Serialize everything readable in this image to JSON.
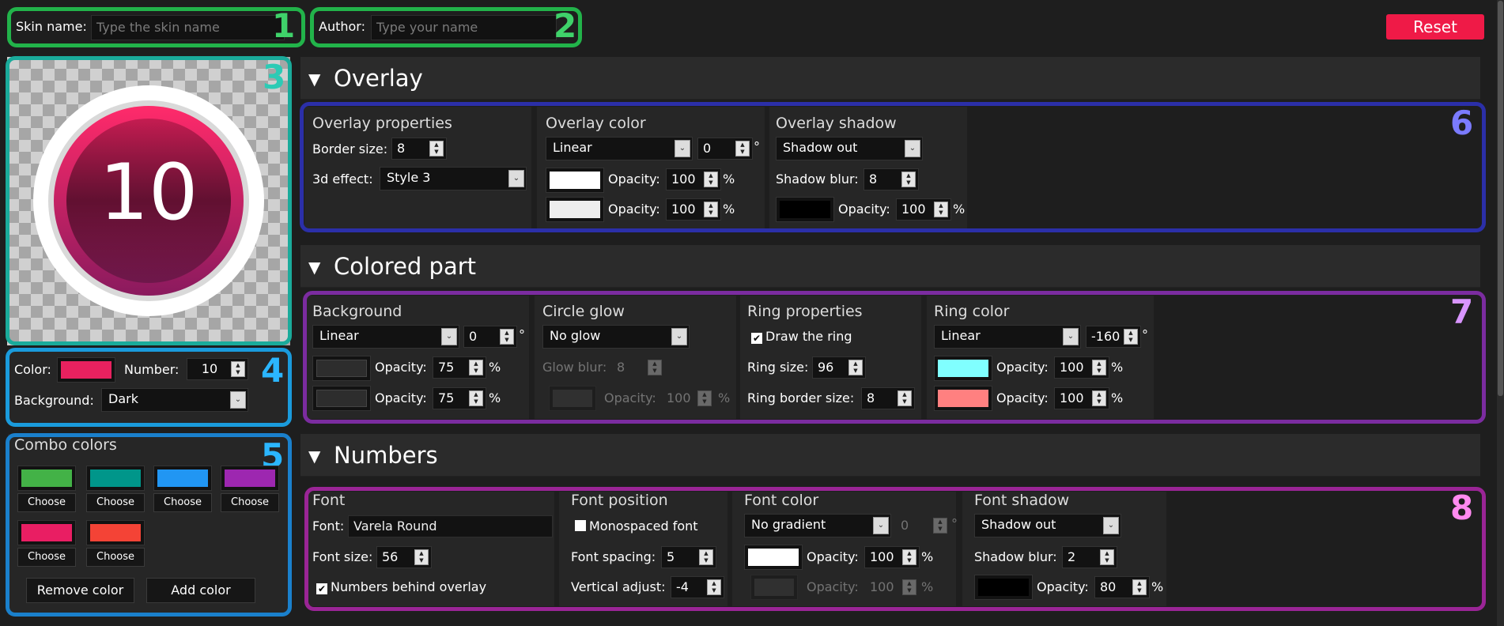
{
  "top": {
    "skin_name_label": "Skin name:",
    "skin_name_placeholder": "Type the skin name",
    "author_label": "Author:",
    "author_placeholder": "Type your name",
    "reset": "Reset"
  },
  "preview": {
    "number": "10"
  },
  "badges": [
    "1",
    "2",
    "3",
    "4",
    "5",
    "6",
    "7",
    "8"
  ],
  "settings": {
    "color_label": "Color:",
    "color": "#e8215f",
    "number_label": "Number:",
    "number": "10",
    "background_label": "Background:",
    "background": "Dark"
  },
  "combo": {
    "title": "Combo colors",
    "colors": [
      "#43b247",
      "#00968a",
      "#2196f3",
      "#9d27b0",
      "#e91e63",
      "#f44336"
    ],
    "choose": "Choose",
    "remove": "Remove color",
    "add": "Add color"
  },
  "overlay": {
    "title": "Overlay",
    "props_title": "Overlay properties",
    "border_label": "Border size:",
    "border": "8",
    "effect_label": "3d effect:",
    "effect": "Style 3",
    "color_title": "Overlay color",
    "gradient": "Linear",
    "angle": "0",
    "deg": "°",
    "opacity_label": "Opacity:",
    "op1": "100",
    "op2": "100",
    "pct": "%",
    "c1": "#ffffff",
    "c2": "#eeeeee",
    "shadow_title": "Overlay shadow",
    "shadow": "Shadow out",
    "blur_label": "Shadow blur:",
    "blur": "8",
    "shadow_color": "#000000",
    "shadow_op": "100"
  },
  "colored": {
    "title": "Colored part",
    "bg_title": "Background",
    "bg_grad": "Linear",
    "bg_angle": "0",
    "bg_op1": "75",
    "bg_op2": "75",
    "glow_title": "Circle glow",
    "glow": "No glow",
    "glow_blur_label": "Glow blur:",
    "glow_blur": "8",
    "glow_op": "100",
    "ring_title": "Ring properties",
    "draw_ring": "Draw the ring",
    "ring_size_label": "Ring size:",
    "ring_size": "96",
    "ring_border_label": "Ring border size:",
    "ring_border": "8",
    "rc_title": "Ring color",
    "rc_grad": "Linear",
    "rc_angle": "-160",
    "rc1": "#80ffff",
    "rc2": "#ff8080",
    "rc_op1": "100",
    "rc_op2": "100"
  },
  "numbers": {
    "title": "Numbers",
    "font_title": "Font",
    "font_label": "Font:",
    "font": "Varela Round",
    "size_label": "Font size:",
    "size": "56",
    "behind": "Numbers behind overlay",
    "pos_title": "Font position",
    "mono": "Monospaced font",
    "spacing_label": "Font spacing:",
    "spacing": "5",
    "vadj_label": "Vertical adjust:",
    "vadj": "-4",
    "fc_title": "Font color",
    "fc_grad": "No gradient",
    "fc_angle": "0",
    "fc_op1": "100",
    "fc_op2": "100",
    "fs_title": "Font shadow",
    "fs": "Shadow out",
    "fs_blur": "2",
    "fs_op": "80"
  }
}
